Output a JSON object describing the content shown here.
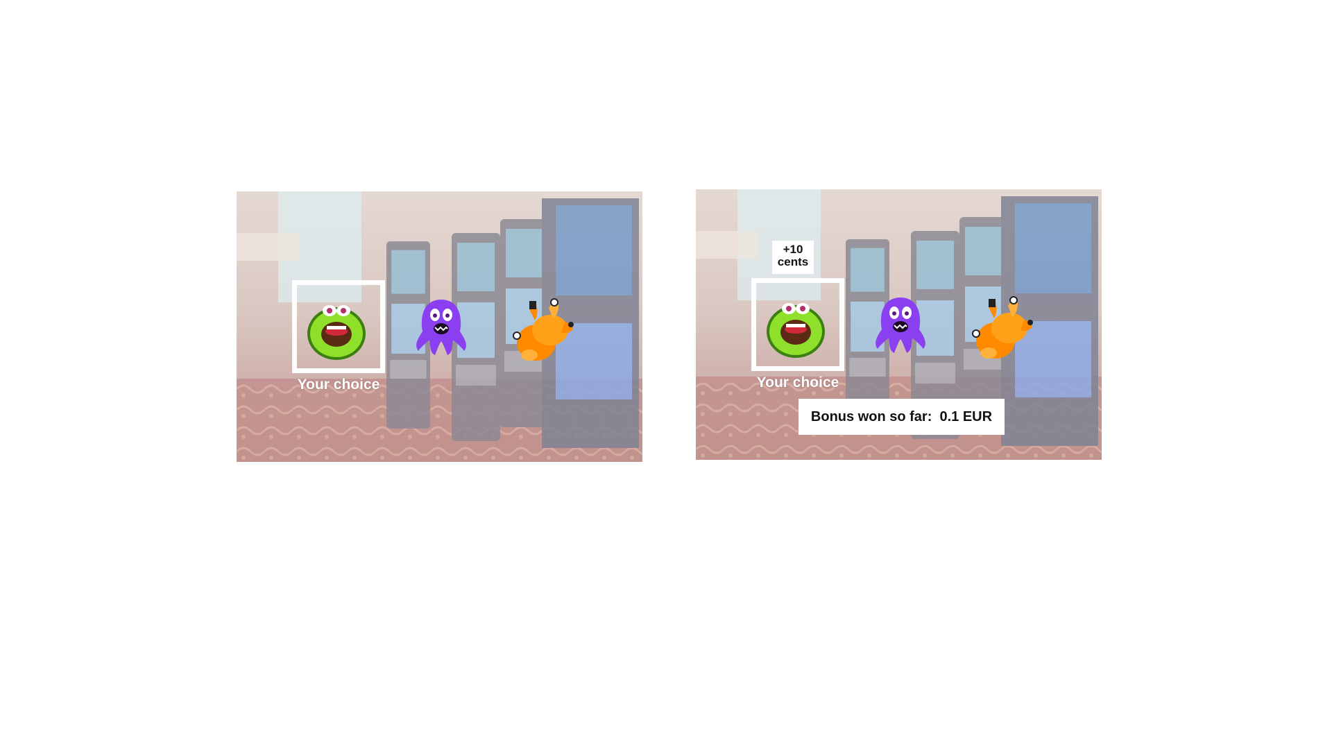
{
  "left_panel": {
    "choice_label": "Your choice"
  },
  "right_panel": {
    "choice_label": "Your choice",
    "reward_line1": "+10",
    "reward_line2": "cents",
    "bonus_label": "Bonus won so far:  ",
    "bonus_value": "0.1 EUR"
  },
  "monsters": [
    "green-avocado-monster-icon",
    "purple-octopus-monster-icon",
    "orange-multi-eyed-monster-icon"
  ],
  "colors": {
    "frame": "#ffffff",
    "green_monster": "#7ed321",
    "purple_monster": "#8a3ff0",
    "orange_monster": "#ff8a00"
  }
}
